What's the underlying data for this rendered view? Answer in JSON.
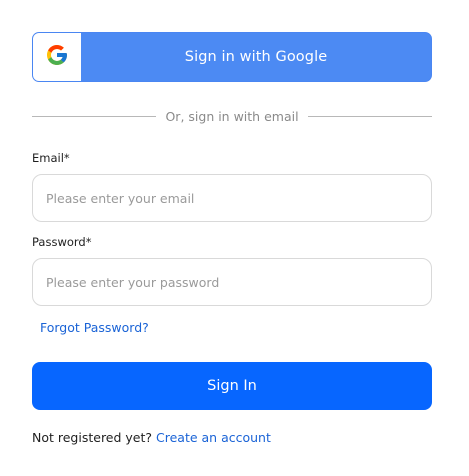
{
  "google_signin": {
    "label": "Sign in with Google",
    "icon": "google-g-icon",
    "colors": {
      "background": "#4c8af3",
      "logo_box": "#ffffff"
    }
  },
  "divider": {
    "text": "Or, sign in with email"
  },
  "email": {
    "label": "Email*",
    "placeholder": "Please enter your email",
    "value": ""
  },
  "password": {
    "label": "Password*",
    "placeholder": "Please enter your password",
    "value": ""
  },
  "forgot_password": {
    "label": "Forgot Password?"
  },
  "signin_button": {
    "label": "Sign In",
    "color": "#0766ff"
  },
  "register": {
    "prompt": "Not registered yet?",
    "link_label": "Create an account"
  },
  "colors": {
    "link": "#1a63d6",
    "primary": "#0766ff",
    "input_border": "#d9d9d9"
  }
}
